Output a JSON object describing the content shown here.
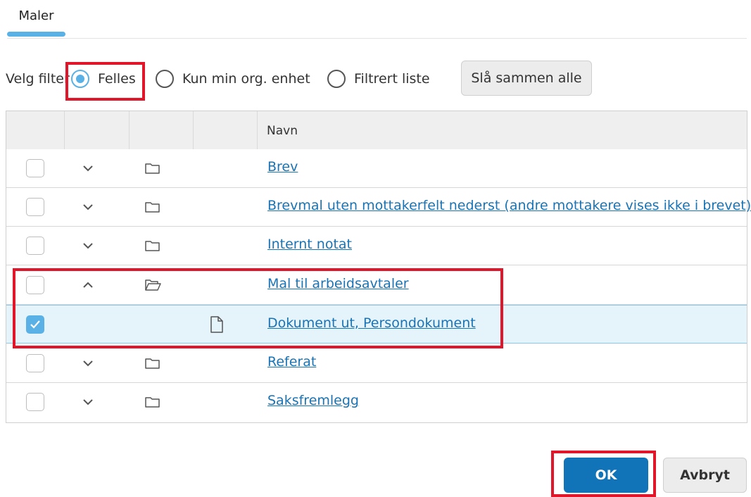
{
  "tabs": [
    {
      "label": "Maler",
      "active": true
    }
  ],
  "filter": {
    "label": "Velg filter",
    "options": [
      {
        "label": "Felles",
        "checked": true
      },
      {
        "label": "Kun min org. enhet",
        "checked": false
      },
      {
        "label": "Filtrert liste",
        "checked": false
      }
    ],
    "merge_button": "Slå sammen alle"
  },
  "table": {
    "columns": [
      "",
      "",
      "",
      "",
      "Navn"
    ],
    "rows": [
      {
        "name": "Brev",
        "checked": false,
        "expanded": false,
        "type": "folder"
      },
      {
        "name": "Brevmal uten mottakerfelt nederst (andre mottakere vises ikke i brevet)",
        "checked": false,
        "expanded": false,
        "type": "folder"
      },
      {
        "name": "Internt notat",
        "checked": false,
        "expanded": false,
        "type": "folder"
      },
      {
        "name": "Mal til arbeidsavtaler",
        "checked": false,
        "expanded": true,
        "type": "folder-open"
      },
      {
        "name": "Dokument ut, Persondokument",
        "checked": true,
        "type": "document"
      },
      {
        "name": "Referat",
        "checked": false,
        "expanded": false,
        "type": "folder"
      },
      {
        "name": "Saksfremlegg",
        "checked": false,
        "expanded": false,
        "type": "folder"
      }
    ]
  },
  "footer": {
    "ok_label": "OK",
    "cancel_label": "Avbryt"
  },
  "colors": {
    "accent": "#5ab1e5",
    "primary_button": "#1173b8",
    "link": "#1a73b5",
    "highlight_box": "#e1162b",
    "selected_row": "#e5f3fb"
  }
}
